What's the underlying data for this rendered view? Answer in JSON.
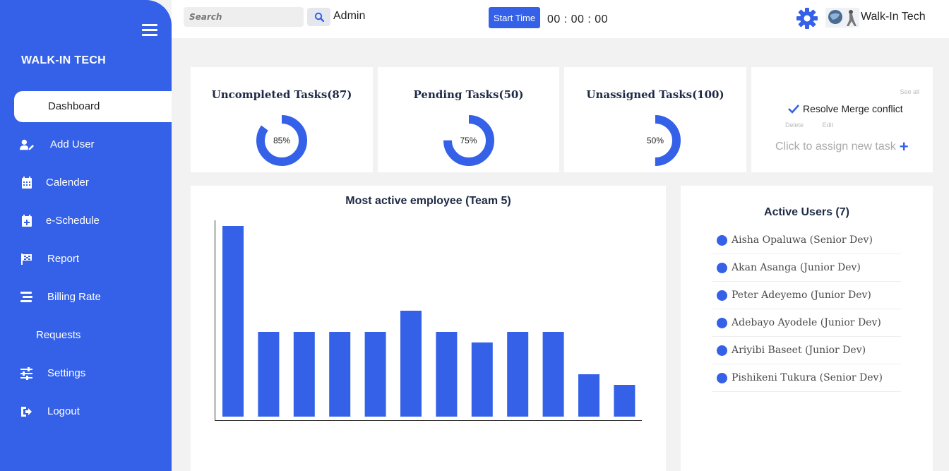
{
  "sidebar": {
    "brand": "WALK-IN TECH",
    "items": [
      {
        "label": "Dashboard",
        "icon": "pie-chart-icon"
      },
      {
        "label": "Add User",
        "icon": "user-edit-icon"
      },
      {
        "label": "Calender",
        "icon": "calendar-icon"
      },
      {
        "label": "e-Schedule",
        "icon": "calendar-plus-icon"
      },
      {
        "label": "Report",
        "icon": "flag-icon"
      },
      {
        "label": "Billing Rate",
        "icon": "stream-icon"
      },
      {
        "label": "Requests",
        "icon": ""
      },
      {
        "label": "Settings",
        "icon": "sliders-icon"
      },
      {
        "label": "Logout",
        "icon": "sign-out-icon"
      }
    ]
  },
  "topbar": {
    "search_placeholder": "Search",
    "user": "Admin",
    "start_label": "Start Time",
    "timer": "00 : 00 : 00",
    "company": "Walk-In Tech"
  },
  "stats": [
    {
      "title": "Uncompleted Tasks(87)",
      "percent": 85,
      "label": "85%"
    },
    {
      "title": "Pending Tasks(50)",
      "percent": 75,
      "label": "75%"
    },
    {
      "title": "Unassigned Tasks(100)",
      "percent": 50,
      "label": "50%"
    }
  ],
  "tasks": {
    "see_all": "See all",
    "item": "Resolve Merge conflict",
    "delete": "Delete",
    "edit": "Edit",
    "assign": "Click to assign new task"
  },
  "chart_data": {
    "type": "bar",
    "title": "Most active employee (Team 5)",
    "values": [
      18,
      8,
      8,
      8,
      8,
      10,
      8,
      7,
      8,
      8,
      4,
      3
    ],
    "ylim": [
      0,
      20
    ],
    "color": "#3461e8"
  },
  "active_users": {
    "title": "Active Users (7)",
    "users": [
      "Aisha Opaluwa (Senior Dev)",
      "Akan Asanga (Junior Dev)",
      "Peter Adeyemo (Junior Dev)",
      "Adebayo Ayodele (Junior Dev)",
      "Ariyibi Baseet (Junior Dev)",
      "Pishikeni Tukura (Senior Dev)"
    ]
  },
  "colors": {
    "accent": "#3461e8",
    "background": "#f2f2f2"
  }
}
